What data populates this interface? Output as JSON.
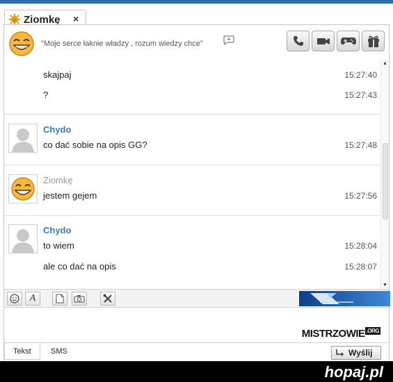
{
  "tab": {
    "title": "Ziomkę",
    "close": "×"
  },
  "header": {
    "status": "\"Moje serce łaknie władzy , rozum wiedzy chce\"",
    "add_status": "+"
  },
  "messages": [
    {
      "sender": "",
      "text": "skajpaj",
      "time": "15:27:40"
    },
    {
      "sender": "",
      "text": "?",
      "time": "15:27:43"
    },
    {
      "sender": "Chydo",
      "text": "co dać sobie na opis GG?",
      "time": "15:27:48"
    },
    {
      "sender": "Ziomkę",
      "text": "jestem gejem",
      "time": "15:27:56"
    },
    {
      "sender": "Chydo",
      "text": "to wiem",
      "time": "15:28:04"
    },
    {
      "sender": "",
      "text": "ale co dać na opis",
      "time": "15:28:07"
    }
  ],
  "toolbar": {
    "font_label": "A"
  },
  "watermark": {
    "main": "MISTRZOWIE",
    "suffix": ".ORG"
  },
  "bottom": {
    "tab_text": "Tekst",
    "tab_sms": "SMS",
    "send_label": "Wyślij"
  },
  "footer": {
    "brand": "hopaj.pl"
  },
  "colors": {
    "link_blue": "#3a7abf",
    "accent": "#2f6ea8"
  },
  "icons": [
    "sun-icon",
    "smiley-avatar-icon",
    "phone-icon",
    "video-camera-icon",
    "gamepad-icon",
    "gift-icon",
    "person-placeholder-icon",
    "emoticon-icon",
    "font-icon",
    "file-icon",
    "camera-icon",
    "tools-icon",
    "send-arrow-icon"
  ]
}
